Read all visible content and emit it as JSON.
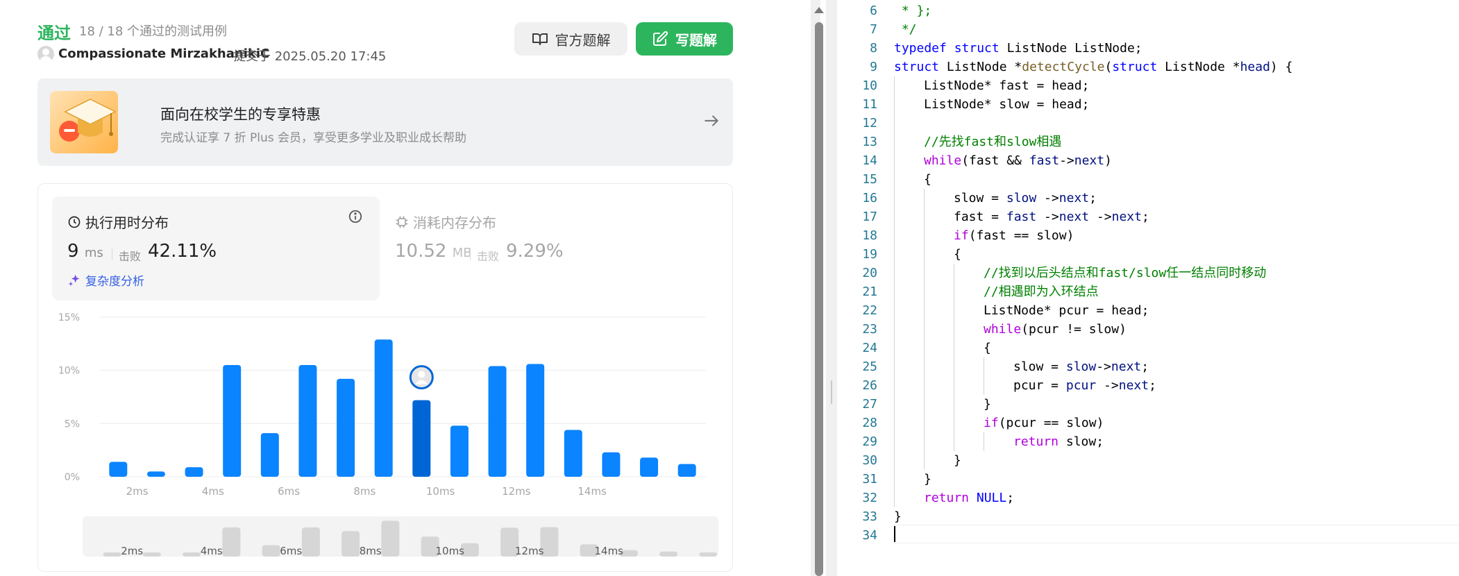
{
  "result": {
    "status": "通过",
    "cases": "18 / 18 个通过的测试用例",
    "author": "Compassionate MirzakhanikiC",
    "submitted": "提交于 2025.05.20 17:45"
  },
  "buttons": {
    "official": "官方题解",
    "write": "写题解"
  },
  "promo": {
    "title": "面向在校学生的专享特惠",
    "subtitle": "完成认证享 7 折 Plus 会员，享受更多学业及职业成长帮助"
  },
  "stats": {
    "runtime": {
      "title": "执行用时分布",
      "value": "9",
      "unit": "ms",
      "beat_label": "击败",
      "beat_value": "42.11%",
      "complexity": "复杂度分析"
    },
    "memory": {
      "title": "消耗内存分布",
      "value": "10.52",
      "unit": "MB",
      "beat_label": "击败",
      "beat_value": "9.29%"
    }
  },
  "chart_data": {
    "type": "bar",
    "categories": [
      "1ms",
      "2ms",
      "3ms",
      "4ms",
      "5ms",
      "6ms",
      "7ms",
      "8ms",
      "9ms",
      "10ms",
      "11ms",
      "12ms",
      "13ms",
      "14ms",
      "15ms",
      "16ms"
    ],
    "values": [
      1.4,
      0.5,
      0.9,
      10.5,
      4.1,
      10.5,
      9.2,
      12.9,
      7.2,
      4.8,
      10.4,
      10.6,
      4.4,
      2.3,
      1.8,
      1.2
    ],
    "highlight_category": "9ms",
    "ylim": [
      0,
      15
    ],
    "yticks": [
      "0%",
      "5%",
      "10%",
      "15%"
    ],
    "xticks": [
      "2ms",
      "4ms",
      "6ms",
      "8ms",
      "10ms",
      "12ms",
      "14ms"
    ],
    "bar_color": "#0a84ff",
    "highlight_color": "#0066d6",
    "grid": true
  },
  "editor": {
    "lines": [
      {
        "n": "6",
        "indent": 0,
        "tokens": [
          {
            "t": " * };",
            "c": "cm"
          }
        ]
      },
      {
        "n": "7",
        "indent": 0,
        "tokens": [
          {
            "t": " */",
            "c": "cm"
          }
        ]
      },
      {
        "n": "8",
        "indent": 0,
        "tokens": [
          {
            "t": "typedef",
            "c": "kw"
          },
          {
            "t": " "
          },
          {
            "t": "struct",
            "c": "kw"
          },
          {
            "t": " ListNode ListNode;"
          }
        ]
      },
      {
        "n": "9",
        "indent": 0,
        "tokens": [
          {
            "t": "struct",
            "c": "kw"
          },
          {
            "t": " ListNode *"
          },
          {
            "t": "detectCycle",
            "c": "fn"
          },
          {
            "t": "("
          },
          {
            "t": "struct",
            "c": "kw"
          },
          {
            "t": " ListNode *"
          },
          {
            "t": "head",
            "c": "var"
          },
          {
            "t": ") {"
          }
        ]
      },
      {
        "n": "10",
        "indent": 1,
        "tokens": [
          {
            "t": "ListNode* fast = head;"
          }
        ]
      },
      {
        "n": "11",
        "indent": 1,
        "tokens": [
          {
            "t": "ListNode* slow = head;"
          }
        ]
      },
      {
        "n": "12",
        "indent": 1,
        "tokens": []
      },
      {
        "n": "13",
        "indent": 1,
        "tokens": [
          {
            "t": "//先找fast和slow相遇",
            "c": "cm"
          }
        ]
      },
      {
        "n": "14",
        "indent": 1,
        "tokens": [
          {
            "t": "while",
            "c": "kw2"
          },
          {
            "t": "(fast && "
          },
          {
            "t": "fast",
            "c": "var"
          },
          {
            "t": "->"
          },
          {
            "t": "next",
            "c": "var"
          },
          {
            "t": ")"
          }
        ]
      },
      {
        "n": "15",
        "indent": 1,
        "tokens": [
          {
            "t": "{"
          }
        ]
      },
      {
        "n": "16",
        "indent": 2,
        "tokens": [
          {
            "t": "slow = "
          },
          {
            "t": "slow",
            "c": "var"
          },
          {
            "t": " ->"
          },
          {
            "t": "next",
            "c": "var"
          },
          {
            "t": ";"
          }
        ]
      },
      {
        "n": "17",
        "indent": 2,
        "tokens": [
          {
            "t": "fast = "
          },
          {
            "t": "fast",
            "c": "var"
          },
          {
            "t": " ->"
          },
          {
            "t": "next",
            "c": "var"
          },
          {
            "t": " ->"
          },
          {
            "t": "next",
            "c": "var"
          },
          {
            "t": ";"
          }
        ]
      },
      {
        "n": "18",
        "indent": 2,
        "tokens": [
          {
            "t": "if",
            "c": "kw2"
          },
          {
            "t": "(fast == slow)"
          }
        ]
      },
      {
        "n": "19",
        "indent": 2,
        "tokens": [
          {
            "t": "{"
          }
        ]
      },
      {
        "n": "20",
        "indent": 3,
        "tokens": [
          {
            "t": "//找到以后头结点和fast/slow任一结点同时移动",
            "c": "cm"
          }
        ]
      },
      {
        "n": "21",
        "indent": 3,
        "tokens": [
          {
            "t": "//相遇即为入环结点",
            "c": "cm"
          }
        ]
      },
      {
        "n": "22",
        "indent": 3,
        "tokens": [
          {
            "t": "ListNode* pcur = head;"
          }
        ]
      },
      {
        "n": "23",
        "indent": 3,
        "tokens": [
          {
            "t": "while",
            "c": "kw2"
          },
          {
            "t": "(pcur != slow)"
          }
        ]
      },
      {
        "n": "24",
        "indent": 3,
        "tokens": [
          {
            "t": "{"
          }
        ]
      },
      {
        "n": "25",
        "indent": 4,
        "tokens": [
          {
            "t": "slow = "
          },
          {
            "t": "slow",
            "c": "var"
          },
          {
            "t": "->"
          },
          {
            "t": "next",
            "c": "var"
          },
          {
            "t": ";"
          }
        ]
      },
      {
        "n": "26",
        "indent": 4,
        "tokens": [
          {
            "t": "pcur = "
          },
          {
            "t": "pcur",
            "c": "var"
          },
          {
            "t": " ->"
          },
          {
            "t": "next",
            "c": "var"
          },
          {
            "t": ";"
          }
        ]
      },
      {
        "n": "27",
        "indent": 3,
        "tokens": [
          {
            "t": "}"
          }
        ]
      },
      {
        "n": "28",
        "indent": 3,
        "tokens": [
          {
            "t": "if",
            "c": "kw2"
          },
          {
            "t": "(pcur == slow)"
          }
        ]
      },
      {
        "n": "29",
        "indent": 4,
        "tokens": [
          {
            "t": "return",
            "c": "kw2"
          },
          {
            "t": " slow;"
          }
        ]
      },
      {
        "n": "30",
        "indent": 2,
        "tokens": [
          {
            "t": "}"
          }
        ]
      },
      {
        "n": "31",
        "indent": 1,
        "tokens": [
          {
            "t": "}"
          }
        ]
      },
      {
        "n": "32",
        "indent": 1,
        "tokens": [
          {
            "t": "return",
            "c": "kw2"
          },
          {
            "t": " "
          },
          {
            "t": "NULL",
            "c": "kw"
          },
          {
            "t": ";"
          }
        ]
      },
      {
        "n": "33",
        "indent": 0,
        "tokens": [
          {
            "t": "}"
          }
        ]
      },
      {
        "n": "34",
        "indent": 0,
        "tokens": []
      }
    ]
  }
}
